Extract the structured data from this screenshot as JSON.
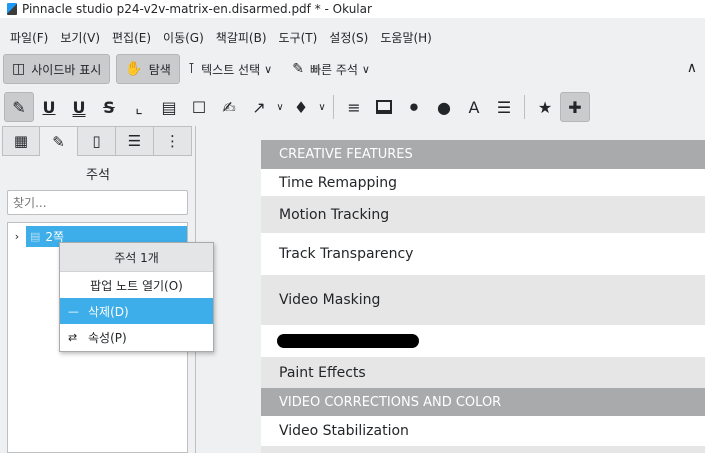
{
  "window": {
    "title": "Pinnacle studio p24-v2v-matrix-en.disarmed.pdf * - Okular"
  },
  "menubar": {
    "items": [
      "파일(F)",
      "보기(V)",
      "편집(E)",
      "이동(G)",
      "책갈피(B)",
      "도구(T)",
      "설정(S)",
      "도움말(H)"
    ]
  },
  "toolbar": {
    "sidebar_label": "사이드바 표시",
    "browse_label": "탐색",
    "text_select_label": "텍스트 선택",
    "quick_annotation_label": "빠른 주석"
  },
  "sidebar": {
    "title": "주석",
    "search_placeholder": "찾기...",
    "tree_item": "2쪽"
  },
  "context_menu": {
    "header": "주석 1개",
    "open_popup": "팝업 노트 열기(O)",
    "delete": "삭제(D)",
    "properties": "속성(P)"
  },
  "document": {
    "header1": "CREATIVE FEATURES",
    "row_time": "Time Remapping",
    "row_motion": "Motion Tracking",
    "row_track": "Track Transparency",
    "row_masking": "Video Masking",
    "row_paint": "Paint Effects",
    "header2": "VIDEO CORRECTIONS AND COLOR",
    "row_stabilization": "Video Stabilization"
  }
}
